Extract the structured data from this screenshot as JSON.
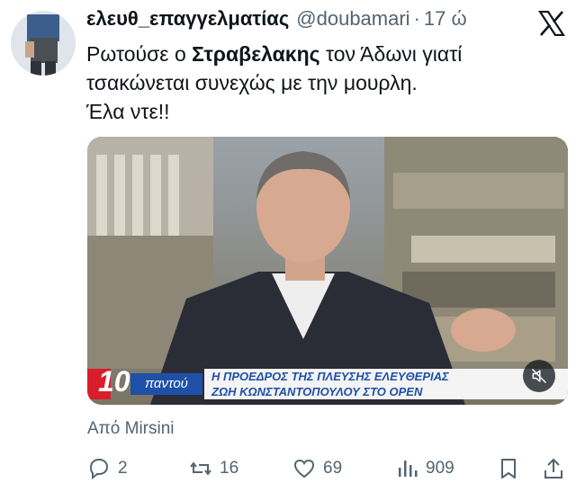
{
  "tweet": {
    "display_name": "ελευθ_επαγγελματίας",
    "handle": "@doubamari",
    "dot": "·",
    "time": "17 ώ",
    "text": {
      "part1": "Ρωτούσε ο ",
      "bold": "Στραβελακης",
      "part2": " τον Άδωνι γιατί τσακώνεται συνεχώς με την μουρλη.",
      "line2": "Έλα ντε!!"
    },
    "source": "Από Mirsini"
  },
  "media": {
    "ticker_number": "10",
    "ticker_label": "παντού",
    "ticker_line1": "Η ΠΡΟΕΔΡΟΣ ΤΗΣ ΠΛΕΥΣΗΣ ΕΛΕΥΘΕΡΙΑΣ",
    "ticker_line2": "ΖΩΗ ΚΩΝΣΤΑΝΤΟΠΟΥΛΟΥ ΣΤΟ OPEN",
    "mute_icon": "speaker-muted-icon"
  },
  "actions": {
    "replies": "2",
    "reposts": "16",
    "likes": "69",
    "views": "909"
  },
  "colors": {
    "text": "#0f1419",
    "secondary": "#536471",
    "ticker_blue": "#1e50a8",
    "ticker_red": "#d81d2b"
  }
}
